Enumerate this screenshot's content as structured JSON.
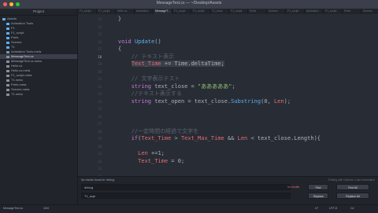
{
  "window": {
    "title": "MessageText.cs — ~/Desktop/Assets",
    "controls": [
      "#ff5f57",
      "#febc2e",
      "#28c840"
    ]
  },
  "sidebar": {
    "header": "Project",
    "items": [
      {
        "label": "Assets",
        "icon": "folder-icon",
        "indent": 0
      },
      {
        "label": "Animation Tools",
        "icon": "folder-icon",
        "indent": 1
      },
      {
        "label": "F1",
        "icon": "folder-icon",
        "indent": 1
      },
      {
        "label": "F1_script",
        "icon": "folder-icon",
        "indent": 1
      },
      {
        "label": "Prefs",
        "icon": "folder-icon",
        "indent": 1
      },
      {
        "label": "Scenes",
        "icon": "folder-icon",
        "indent": 1
      },
      {
        "label": "T1",
        "icon": "folder-icon",
        "indent": 1
      },
      {
        "label": "Animation Tools.meta",
        "icon": "file-icon",
        "indent": 1
      },
      {
        "label": "MessageText.cs",
        "icon": "file-icon",
        "indent": 1
      },
      {
        "label": "MessageText.cs.meta",
        "icon": "file-icon",
        "indent": 1
      },
      {
        "label": "Hello.cs",
        "icon": "file-icon",
        "indent": 1
      },
      {
        "label": "Hello.cs.meta",
        "icon": "file-icon",
        "indent": 1
      },
      {
        "label": "F1_script.meta",
        "icon": "file-icon",
        "indent": 1
      },
      {
        "label": "T1.meta",
        "icon": "file-icon",
        "indent": 1
      },
      {
        "label": "Prefs.meta",
        "icon": "file-icon",
        "indent": 1
      },
      {
        "label": "Scenes.meta",
        "icon": "file-icon",
        "indent": 1
      },
      {
        "label": "T1.meta",
        "icon": "file-icon",
        "indent": 1
      }
    ],
    "selected_index": 8
  },
  "tabs": [
    {
      "label": "F1_script"
    },
    {
      "label": "F1_script"
    },
    {
      "label": "Hello.cs"
    },
    {
      "label": "Animation"
    },
    {
      "label": "MessageT..."
    },
    {
      "label": "F1_script"
    },
    {
      "label": "F1_script"
    },
    {
      "label": "T1_mscr"
    },
    {
      "label": "F1_script"
    },
    {
      "label": "Prefs"
    },
    {
      "label": "Scenes"
    },
    {
      "label": "F1_script"
    },
    {
      "label": "Animation"
    },
    {
      "label": "F1_script"
    },
    {
      "label": "Prefs"
    },
    {
      "label": "Scenes"
    }
  ],
  "active_tab": 4,
  "editor": {
    "current_line": "18",
    "lines": [
      {
        "n": "13",
        "text": "    }"
      },
      {
        "n": "14",
        "text": ""
      },
      {
        "n": "15",
        "text": ""
      },
      {
        "n": "16",
        "text": "    void Update()"
      },
      {
        "n": "17",
        "text": "    {"
      },
      {
        "n": "18",
        "text": "        // テキスト表示"
      },
      {
        "n": "19",
        "text": "        Text_Time += Time.deltaTime;"
      },
      {
        "n": "20",
        "text": ""
      },
      {
        "n": "21",
        "text": "        // 文字表示テスト"
      },
      {
        "n": "22",
        "text": "        string text_close = \"あああああ\";"
      },
      {
        "n": "23",
        "text": "        //テキスト表示する"
      },
      {
        "n": "24",
        "text": "        string text_open = text_close.Substring(0, Len);"
      },
      {
        "n": "25",
        "text": ""
      },
      {
        "n": "26",
        "text": ""
      },
      {
        "n": "27",
        "text": ""
      },
      {
        "n": "28",
        "text": "        //一定時間の経過で文字を"
      },
      {
        "n": "29",
        "text": "        if(Text_Time > Text_Max_Time && Len < text_close.Length){"
      },
      {
        "n": "30",
        "text": ""
      },
      {
        "n": "31",
        "text": "          Len +=1;"
      },
      {
        "n": "32",
        "text": "          Text_Time = 0;"
      },
      {
        "n": "33",
        "text": ""
      },
      {
        "n": "34",
        "text": ""
      },
      {
        "n": "35",
        "text": ""
      }
    ]
  },
  "find": {
    "status": "No results found for 'debug'",
    "search_value": "debug",
    "search_placeholder": "Find in current buffer",
    "replace_value": "T1_acje",
    "replace_placeholder": "Replace in current buffer",
    "info": "Finding with Options: Case Insensitive",
    "count": "no results",
    "find_btn": "Find",
    "find_all_btn": "Find All",
    "replace_btn": "Replace",
    "replace_all_btn": "Replace All"
  },
  "status_bar": {
    "file": "MessageText.cs",
    "cursor": "18:8",
    "encoding": "UTF-8",
    "grammar": "C#",
    "line_ending": "LF"
  }
}
